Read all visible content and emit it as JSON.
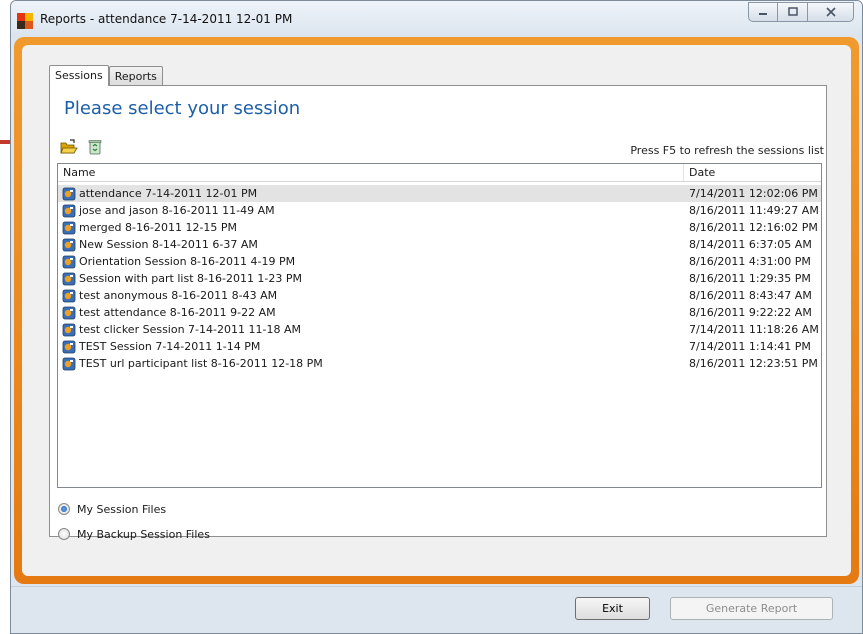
{
  "window": {
    "title": "Reports - attendance 7-14-2011 12-01 PM"
  },
  "tabs": [
    {
      "label": "Sessions",
      "active": true
    },
    {
      "label": "Reports",
      "active": false
    }
  ],
  "main": {
    "heading": "Please select your session",
    "refresh_hint": "Press F5 to refresh the sessions list",
    "toolbar": {
      "open_icon": "open-folder-icon",
      "delete_icon": "recycle-bin-icon"
    }
  },
  "list": {
    "columns": {
      "name": "Name",
      "date": "Date"
    },
    "rows": [
      {
        "name": "attendance 7-14-2011 12-01 PM",
        "date": "7/14/2011 12:02:06 PM",
        "selected": true
      },
      {
        "name": "jose and jason 8-16-2011 11-49 AM",
        "date": "8/16/2011 11:49:27 AM"
      },
      {
        "name": "merged 8-16-2011 12-15 PM",
        "date": "8/16/2011 12:16:02 PM"
      },
      {
        "name": "New Session 8-14-2011 6-37 AM",
        "date": "8/14/2011 6:37:05 AM"
      },
      {
        "name": "Orientation Session 8-16-2011 4-19 PM",
        "date": "8/16/2011 4:31:00 PM"
      },
      {
        "name": "Session  with part list 8-16-2011 1-23 PM",
        "date": "8/16/2011 1:29:35 PM"
      },
      {
        "name": "test anonymous 8-16-2011 8-43 AM",
        "date": "8/16/2011 8:43:47 AM"
      },
      {
        "name": "test attendance 8-16-2011 9-22 AM",
        "date": "8/16/2011 9:22:22 AM"
      },
      {
        "name": "test clicker Session 7-14-2011 11-18 AM",
        "date": "7/14/2011 11:18:26 AM"
      },
      {
        "name": "TEST Session 7-14-2011 1-14 PM",
        "date": "7/14/2011 1:14:41 PM"
      },
      {
        "name": "TEST url participant list 8-16-2011 12-18 PM",
        "date": "8/16/2011 12:23:51 PM"
      }
    ]
  },
  "options": {
    "my_session_files": "My Session Files",
    "my_backup_session_files": "My Backup Session Files",
    "selected": "my_session_files"
  },
  "buttons": {
    "exit": "Exit",
    "generate_report": "Generate Report"
  },
  "colors": {
    "accent_orange": "#e98522",
    "heading_blue": "#1c5fa8",
    "annotation_arrow": "#c0392b"
  }
}
